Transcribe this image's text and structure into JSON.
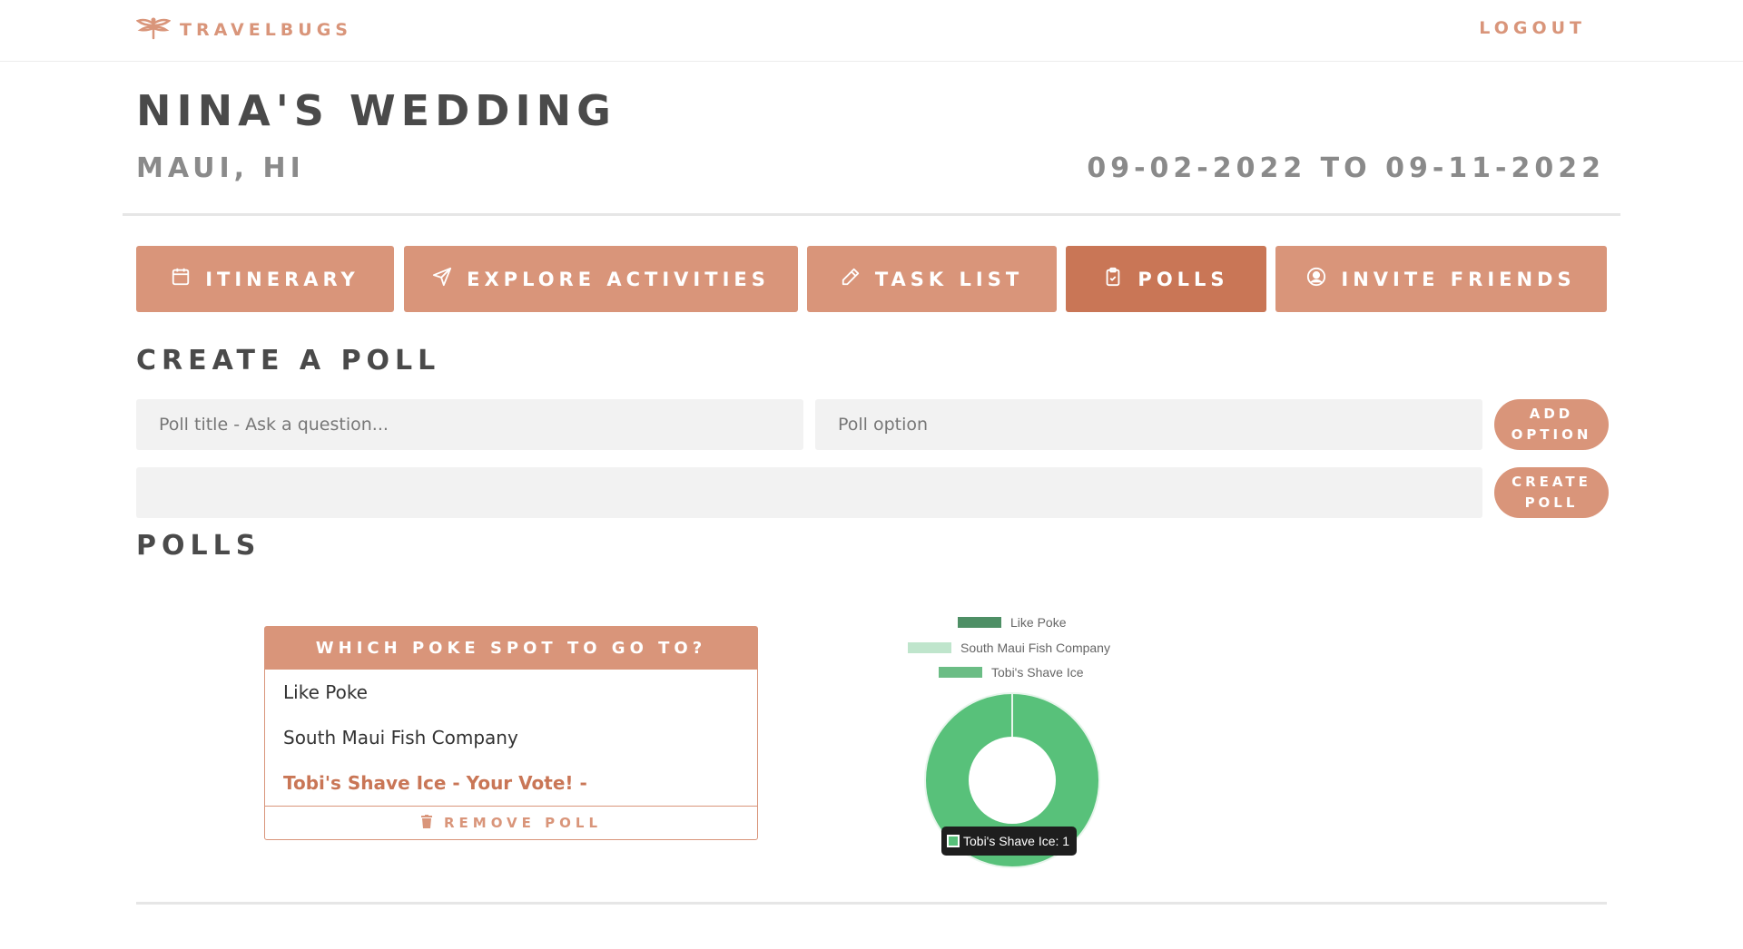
{
  "header": {
    "brand": "TRAVELBUGS",
    "logout_label": "LOGOUT",
    "accent_color": "#d9957a"
  },
  "trip": {
    "title": "NINA'S WEDDING",
    "location": "MAUI, HI",
    "dates": "09-02-2022 TO 09-11-2022"
  },
  "tabs": [
    {
      "label": "ITINERARY",
      "icon": "calendar-icon",
      "active": false
    },
    {
      "label": "EXPLORE ACTIVITIES",
      "icon": "paper-plane-icon",
      "active": false
    },
    {
      "label": "TASK LIST",
      "icon": "pencil-icon",
      "active": false
    },
    {
      "label": "POLLS",
      "icon": "clipboard-icon",
      "active": true
    },
    {
      "label": "INVITE FRIENDS",
      "icon": "user-circle-icon",
      "active": false
    }
  ],
  "create_poll": {
    "section_title": "CREATE A POLL",
    "title_placeholder": "Poll title - Ask a question...",
    "option_placeholder": "Poll option",
    "add_option_line1": "ADD",
    "add_option_line2": "OPTION",
    "create_poll_line1": "CREATE",
    "create_poll_line2": "POLL",
    "options_value": ""
  },
  "polls_section": {
    "section_title": "POLLS",
    "poll": {
      "question": "WHICH POKE SPOT TO GO TO?",
      "options": [
        {
          "label": "Like Poke",
          "voted": false
        },
        {
          "label": "South Maui Fish Company",
          "voted": false
        },
        {
          "label": "Tobi's Shave Ice - Your Vote! -",
          "voted": true
        }
      ],
      "remove_label": "REMOVE POLL"
    }
  },
  "chart_data": {
    "type": "pie",
    "categories": [
      "Like Poke",
      "South Maui Fish Company",
      "Tobi's Shave Ice"
    ],
    "values": [
      0,
      0,
      1
    ],
    "colors": [
      "#4e8f65",
      "#bfe5cc",
      "#6bbd85"
    ],
    "legend": "top",
    "tooltip": "Tobi's Shave Ice: 1"
  }
}
